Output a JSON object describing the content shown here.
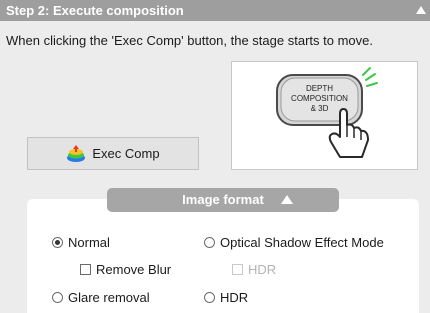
{
  "section": {
    "title": "Step 2: Execute composition",
    "instruction": "When clicking the 'Exec Comp' button, the stage starts to move."
  },
  "illustration": {
    "button_lines": [
      "DEPTH",
      "COMPOSITION",
      "& 3D"
    ]
  },
  "exec_button": {
    "label": "Exec Comp",
    "icon": "stack-layers-icon"
  },
  "image_format": {
    "title": "Image format",
    "options": {
      "normal": {
        "label": "Normal",
        "selected": true
      },
      "optical_shadow": {
        "label": "Optical Shadow Effect Mode",
        "selected": false
      },
      "remove_blur": {
        "label": "Remove Blur",
        "checked": false
      },
      "hdr_check": {
        "label": "HDR",
        "checked": false,
        "disabled": true
      },
      "glare_removal": {
        "label": "Glare removal",
        "selected": false
      },
      "hdr_radio": {
        "label": "HDR",
        "selected": false
      }
    }
  },
  "colors": {
    "header_bg": "#9e9e9e",
    "background": "#ececec",
    "panel_bg": "#ffffff",
    "accent_green": "#3cc84a"
  }
}
